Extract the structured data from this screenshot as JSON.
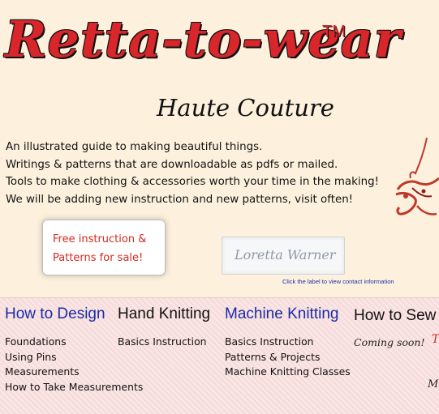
{
  "logo": {
    "title": "Retta-to-wear",
    "trademark": "TM"
  },
  "tagline": "Haute Couture",
  "intro_lines": [
    "An illustrated guide to making beautiful things.",
    "Writings & patterns that are downloadable as pdfs or mailed.",
    "Tools to make clothing & accessories worth your time in the making!",
    "We will be adding new instruction and new patterns, visit often!"
  ],
  "badge": {
    "line1": "Free instruction &",
    "line2": "Patterns for sale!"
  },
  "label": {
    "text": "Loretta Warner",
    "caption": "Click the label to view contact information"
  },
  "nav": {
    "design": {
      "heading": "How to Design",
      "items": [
        "Foundations",
        "Using Pins",
        "Measurements",
        "How to Take Measurements"
      ]
    },
    "hand_knitting": {
      "heading": "Hand Knitting",
      "items": [
        "Basics Instruction"
      ]
    },
    "machine_knitting": {
      "heading": "Machine Knitting",
      "items": [
        "Basics Instruction",
        "Patterns & Projects",
        "Machine Knitting Classes"
      ]
    },
    "sew": {
      "heading": "How to Sew",
      "status": "Coming soon!"
    }
  },
  "colors": {
    "logo_red": "#d8262a",
    "link_blue": "#1a2ba6",
    "badge_red": "#d62a1f",
    "page_bg": "#fdf1de",
    "nav_bg": "#f7dcdc"
  }
}
